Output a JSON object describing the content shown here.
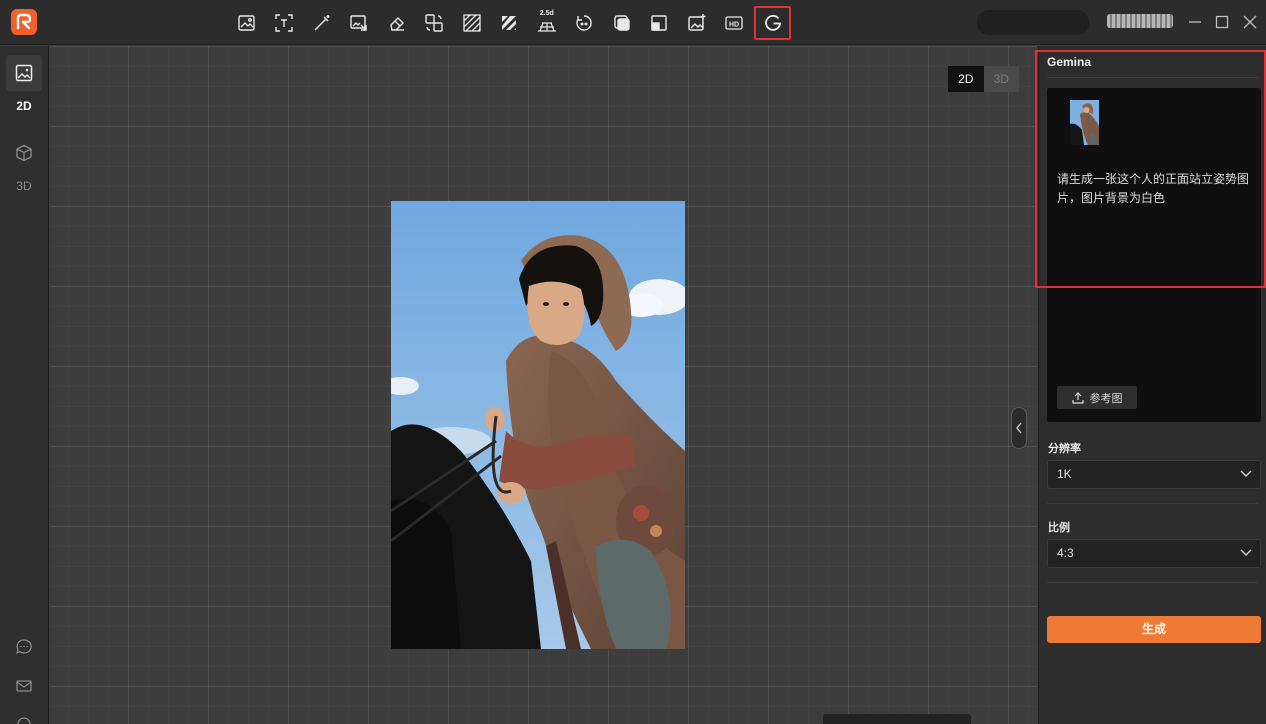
{
  "toolbar": {
    "tools": [
      {
        "name": "image-edit"
      },
      {
        "name": "ocr-text"
      },
      {
        "name": "magic-wand"
      },
      {
        "name": "image-replace"
      },
      {
        "name": "eraser"
      },
      {
        "name": "swap-image"
      },
      {
        "name": "texture"
      },
      {
        "name": "slash-pattern"
      },
      {
        "name": "perspective-grid",
        "label": "2.5d"
      },
      {
        "name": "face-swap"
      },
      {
        "name": "layers"
      },
      {
        "name": "crop-square"
      },
      {
        "name": "add-image"
      },
      {
        "name": "hd-upscale",
        "label": "HD"
      },
      {
        "name": "gemini-g",
        "label": "G",
        "active": true
      }
    ]
  },
  "sidebar": {
    "items": [
      {
        "label": "2D",
        "icon": "image-icon",
        "active": true
      },
      {
        "label": "3D",
        "icon": "cube-icon",
        "active": false
      }
    ]
  },
  "canvas": {
    "mode_2d": "2D",
    "mode_3d": "3D"
  },
  "panel": {
    "title": "Gemina",
    "prompt": "请生成一张这个人的正面站立姿势图片，图片背景为白色",
    "ref_button": "参考图",
    "resolution_label": "分辨率",
    "resolution_value": "1K",
    "ratio_label": "比例",
    "ratio_value": "4:3",
    "generate_label": "生成"
  },
  "colors": {
    "accent": "#ef7a35",
    "highlight": "#e0313a",
    "brand": "#f0612b"
  }
}
